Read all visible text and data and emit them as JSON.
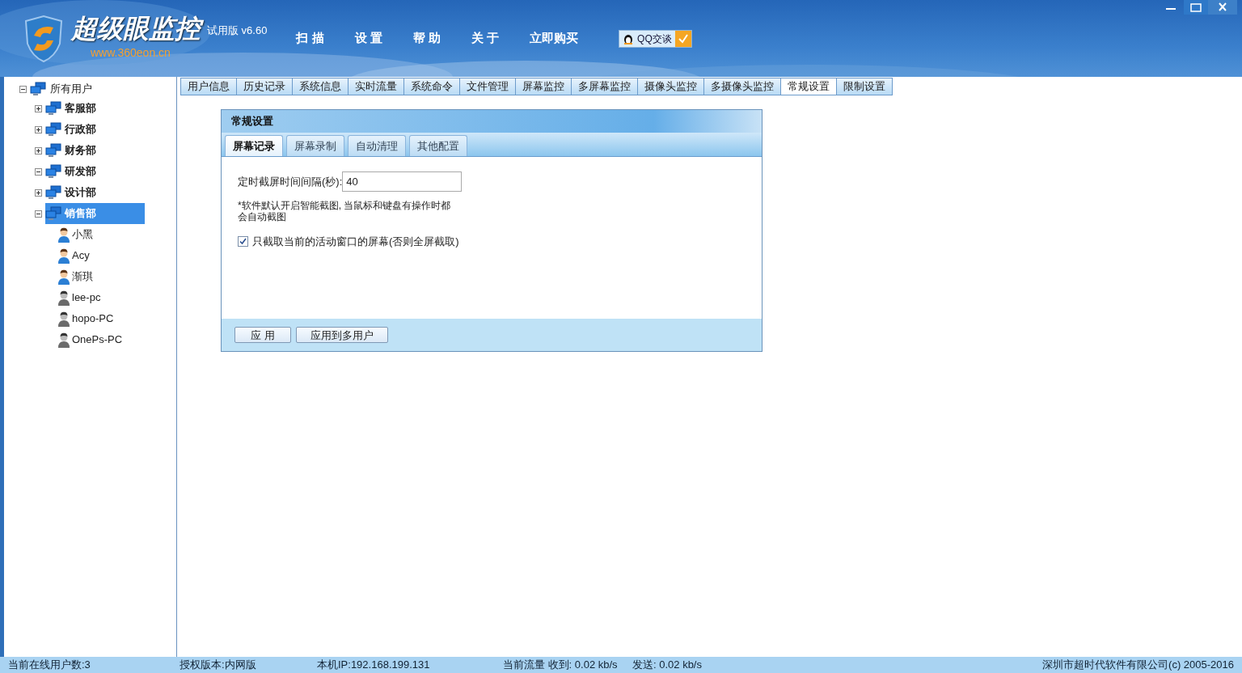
{
  "header": {
    "app_name": "超级眼监控",
    "website": "www.360eon.cn",
    "edition": "试用版 v6.60",
    "menu": [
      "扫 描",
      "设 置",
      "帮 助",
      "关 于",
      "立即购买"
    ],
    "qq_button": "QQ交谈"
  },
  "tree": {
    "label": "所有用户",
    "expanded": true,
    "selected": false,
    "children": [
      {
        "label": "客服部",
        "expanded": false,
        "selected": false
      },
      {
        "label": "行政部",
        "expanded": false,
        "selected": false
      },
      {
        "label": "财务部",
        "expanded": false,
        "selected": false
      },
      {
        "label": "研发部",
        "expanded": true,
        "selected": false
      },
      {
        "label": "设计部",
        "expanded": false,
        "selected": false
      },
      {
        "label": "销售部",
        "expanded": true,
        "selected": true,
        "users": [
          {
            "label": "小黑",
            "online": true
          },
          {
            "label": "Acy",
            "online": true
          },
          {
            "label": "渐琪",
            "online": true
          },
          {
            "label": "lee-pc",
            "online": false
          },
          {
            "label": "hopo-PC",
            "online": false
          },
          {
            "label": "OnePs-PC",
            "online": false
          }
        ]
      }
    ]
  },
  "tabs": [
    {
      "label": "用户信息",
      "selected": false
    },
    {
      "label": "历史记录",
      "selected": false
    },
    {
      "label": "系统信息",
      "selected": false
    },
    {
      "label": "实时流量",
      "selected": false
    },
    {
      "label": "系统命令",
      "selected": false
    },
    {
      "label": "文件管理",
      "selected": false
    },
    {
      "label": "屏幕监控",
      "selected": false
    },
    {
      "label": "多屏幕监控",
      "selected": false
    },
    {
      "label": "摄像头监控",
      "selected": false
    },
    {
      "label": "多摄像头监控",
      "selected": false
    },
    {
      "label": "常规设置",
      "selected": true
    },
    {
      "label": "限制设置",
      "selected": false
    }
  ],
  "panel": {
    "title": "常规设置",
    "subtabs": [
      {
        "label": "屏幕记录",
        "selected": true
      },
      {
        "label": "屏幕录制",
        "selected": false
      },
      {
        "label": "自动清理",
        "selected": false
      },
      {
        "label": "其他配置",
        "selected": false
      }
    ],
    "interval_label": "定时截屏时间间隔(秒):",
    "interval_value": "40",
    "note": "*软件默认开启智能截图, 当鼠标和键盘有操作时都会自动截图",
    "active_window_only": {
      "label": "只截取当前的活动窗口的屏幕(否则全屏截取)",
      "checked": true
    },
    "buttons": [
      "应 用",
      "应用到多用户"
    ]
  },
  "status_bar": [
    "当前在线用户数:3",
    "授权版本:内网版",
    "本机IP:192.168.199.131",
    "当前流量 收到: 0.02 kb/s",
    "发送: 0.02 kb/s",
    "深圳市超时代软件有限公司(c) 2005-2016"
  ]
}
